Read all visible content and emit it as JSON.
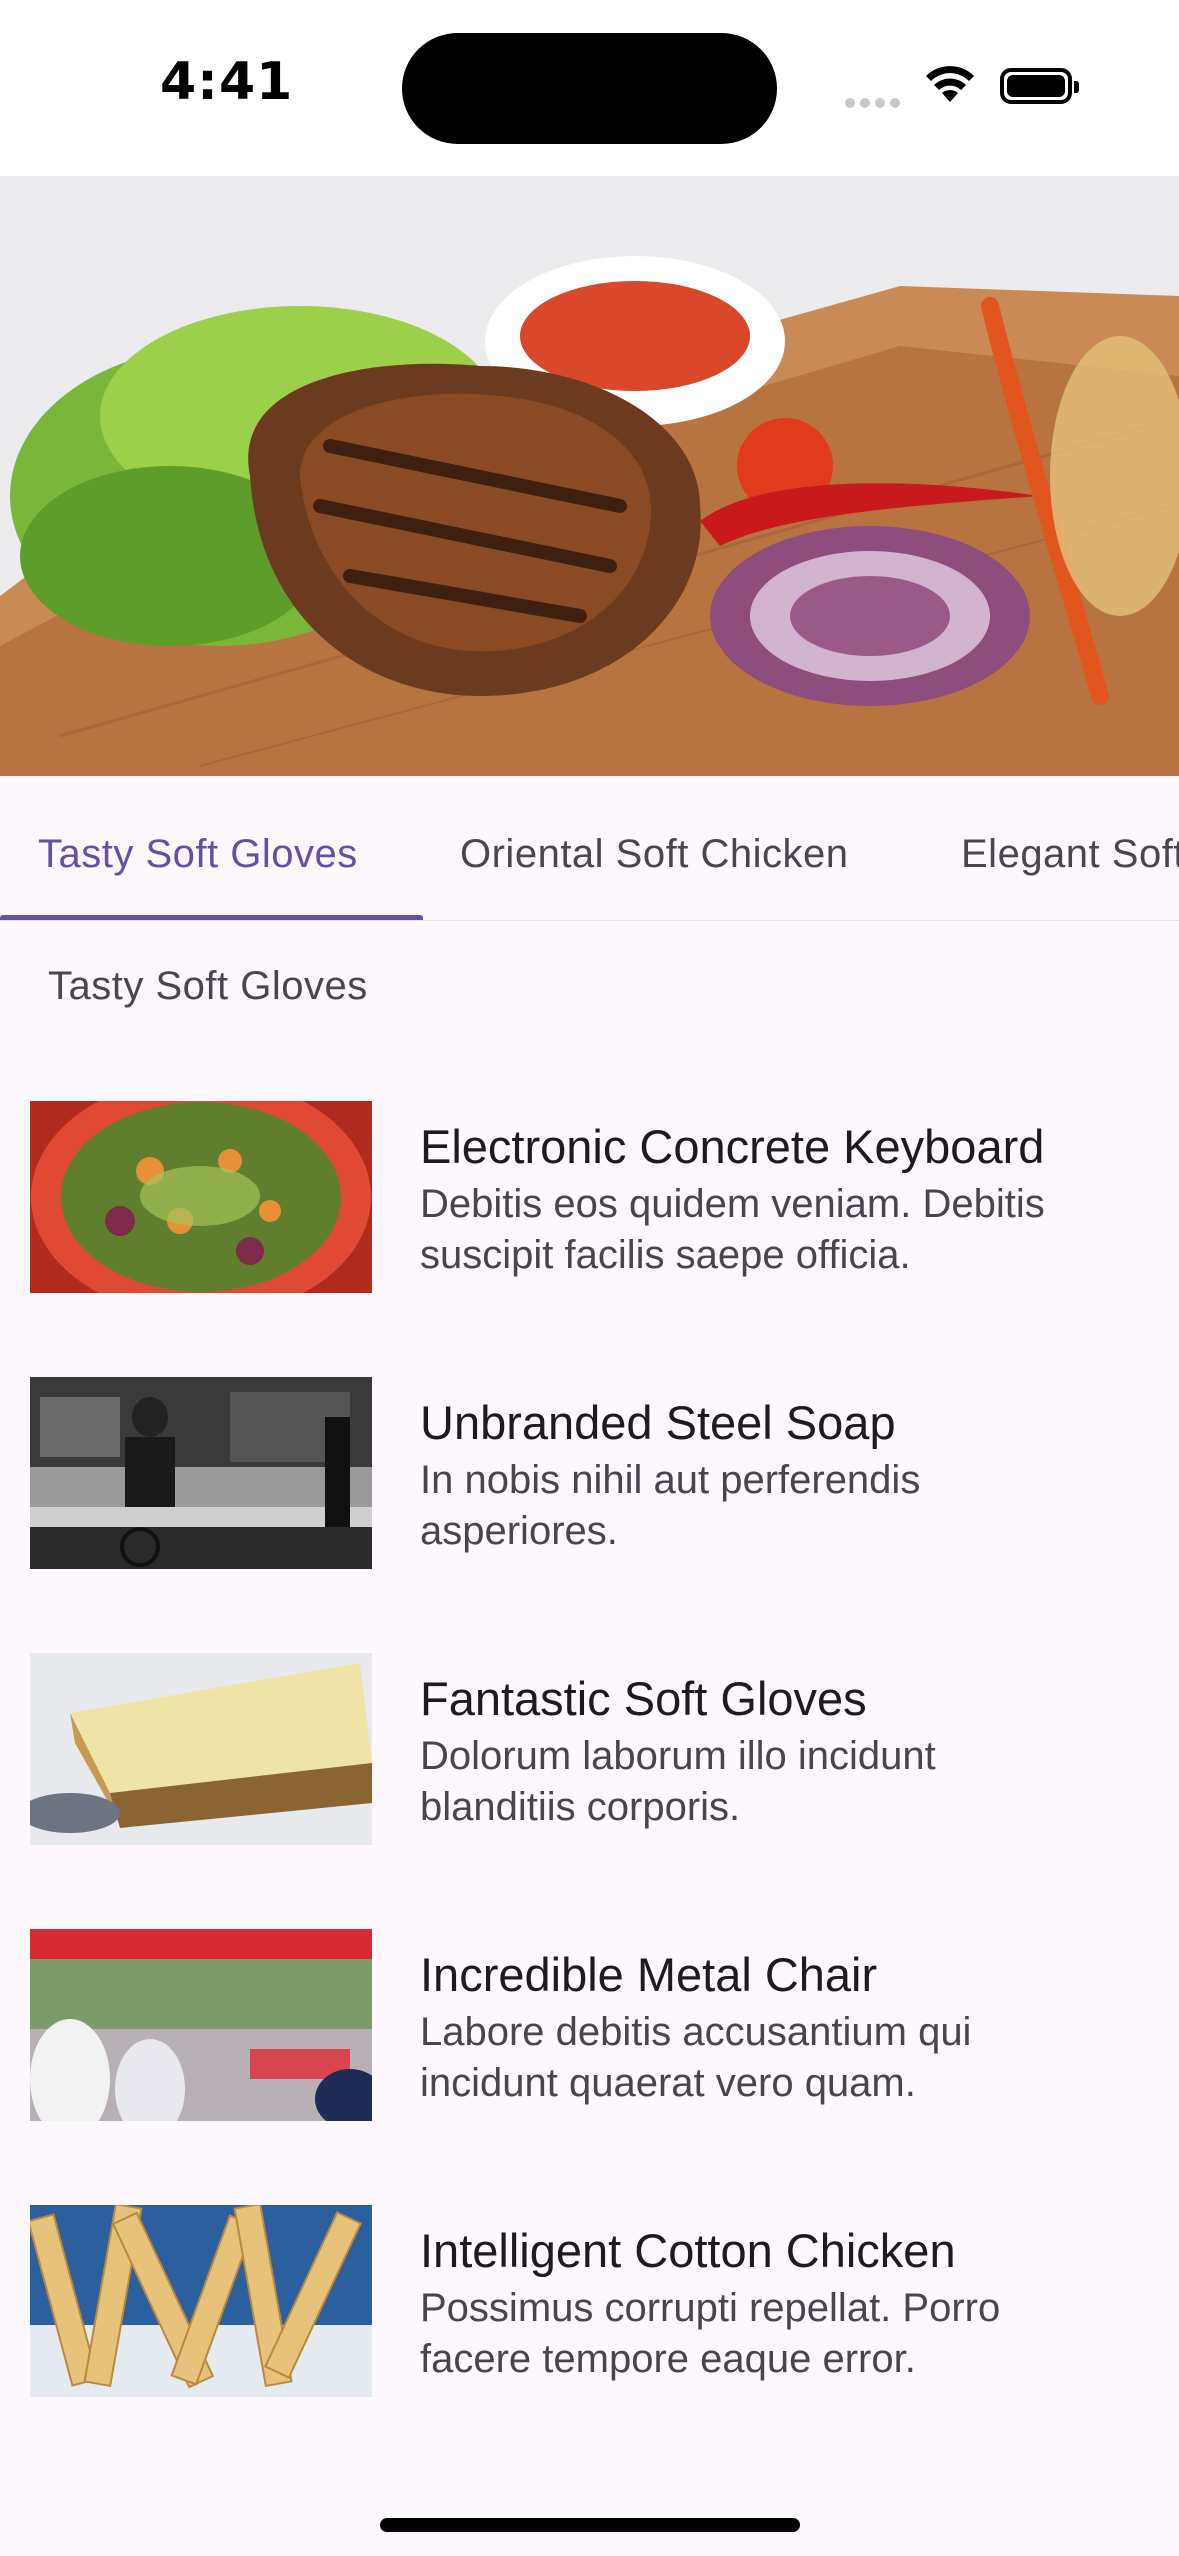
{
  "status_bar": {
    "time": "4:41",
    "icons": [
      "cellular-signal-icon",
      "wifi-icon",
      "battery-icon"
    ]
  },
  "hero": {
    "image": "grilled-steak-platter-image"
  },
  "tabs": [
    {
      "label": "Tasty Soft Gloves",
      "active": true
    },
    {
      "label": "Oriental Soft Chicken",
      "active": false
    },
    {
      "label": "Elegant Soft Chicken",
      "active": false
    }
  ],
  "section": {
    "title": "Tasty Soft Gloves"
  },
  "items": [
    {
      "title": "Electronic Concrete Keyboard",
      "description": "Debitis eos quidem veniam. Debitis suscipit facilis saepe officia.",
      "thumb": "salad-bowl-image"
    },
    {
      "title": "Unbranded Steel Soap",
      "description": "In nobis nihil aut perferendis asperiores.",
      "thumb": "street-cyclist-bw-image"
    },
    {
      "title": "Fantastic Soft Gloves",
      "description": "Dolorum laborum illo incidunt blanditiis corporis.",
      "thumb": "cheesecake-slice-image"
    },
    {
      "title": "Incredible Metal Chair",
      "description": "Labore debitis accusantium qui incidunt quaerat vero quam.",
      "thumb": "outdoor-market-image"
    },
    {
      "title": "Intelligent Cotton Chicken",
      "description": "Possimus corrupti repellat. Porro facere tempore eaque error.",
      "thumb": "french-fries-image"
    }
  ],
  "colors": {
    "accent": "#6750a4",
    "background": "#fdf8fd",
    "title_text": "#1d1b20",
    "body_text": "#49454f"
  }
}
